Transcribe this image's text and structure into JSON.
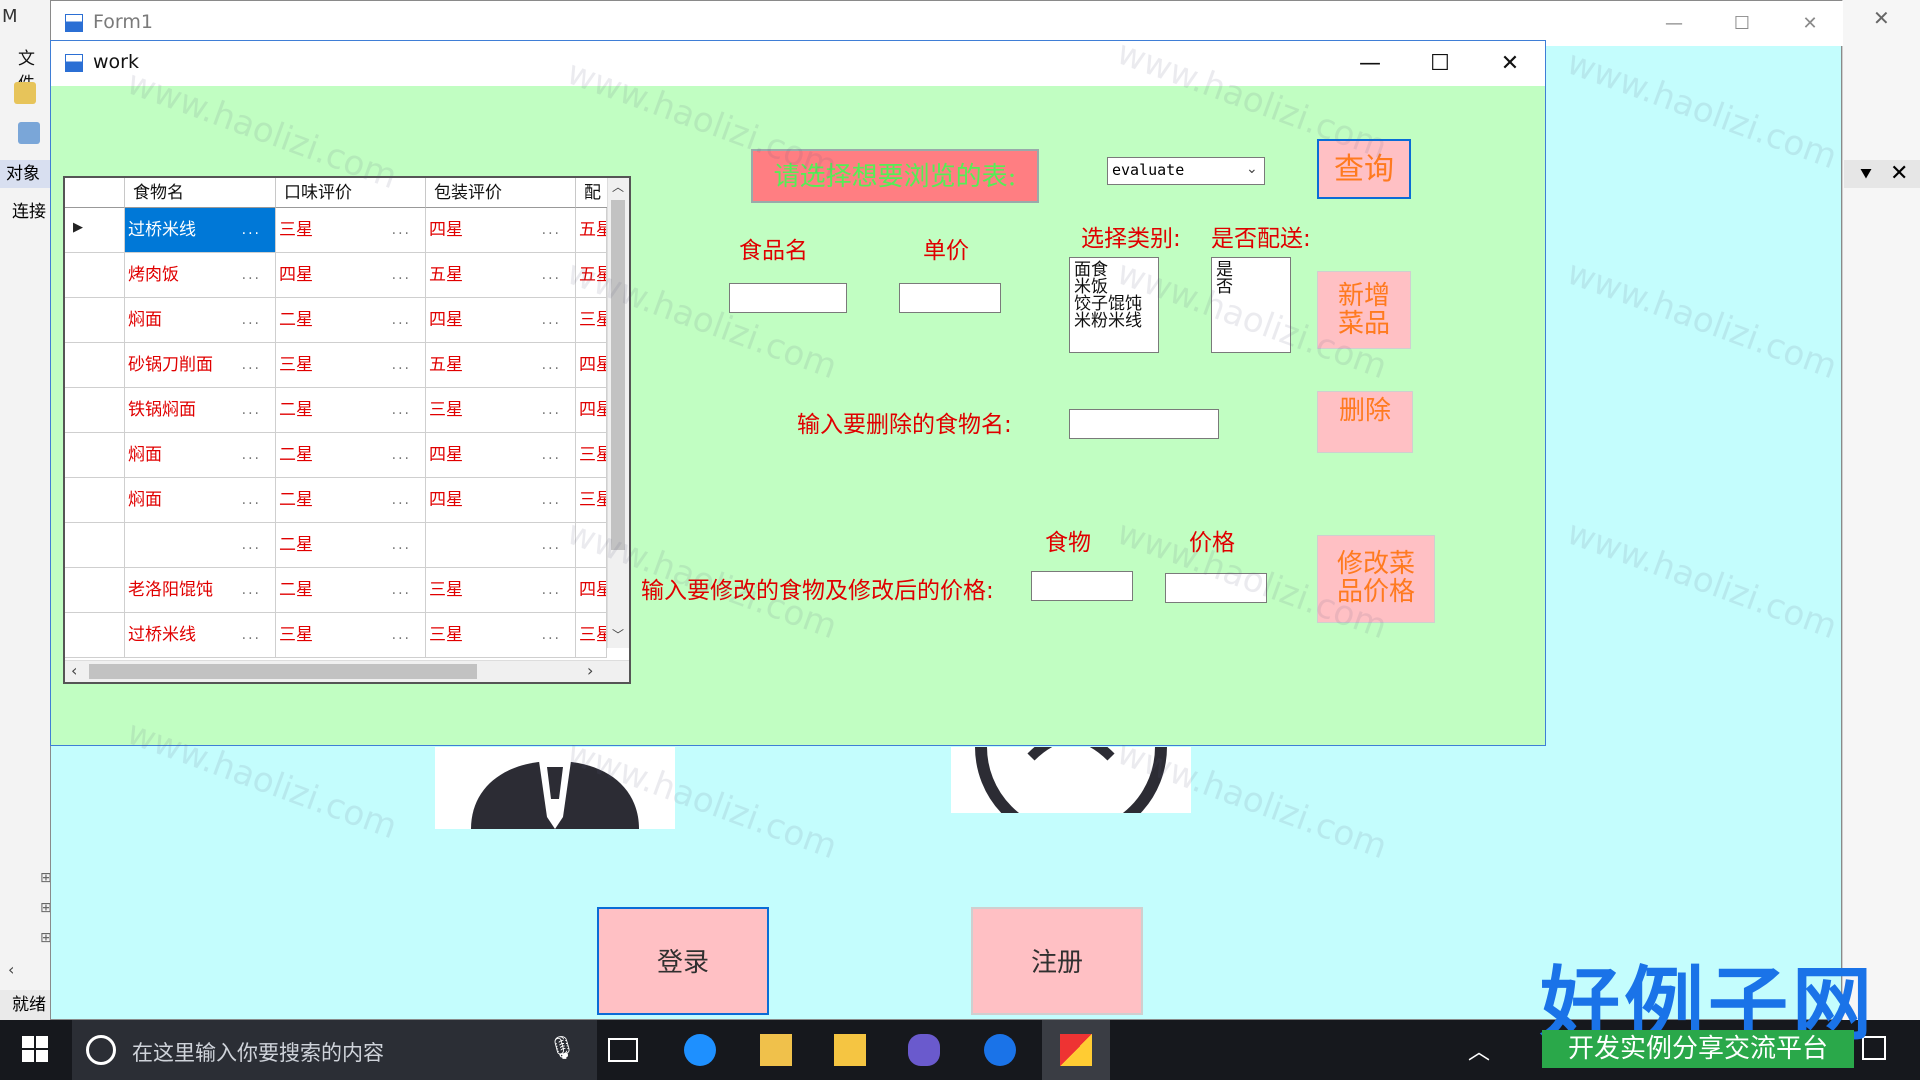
{
  "ide": {
    "title_fragment": "M",
    "menu_fragment": "文件",
    "tab_object": "对象",
    "tab_connect": "连接",
    "status": "就绪"
  },
  "form1": {
    "title": "Form1",
    "login_button": "登录",
    "register_button": "注册"
  },
  "work": {
    "title": "work",
    "browse_label": "请选择想要浏览的表:",
    "table_select_value": "evaluate",
    "query_button": "查询",
    "food_name_label": "食品名",
    "price_label": "单价",
    "category_label": "选择类别:",
    "delivery_label": "是否配送:",
    "categories": [
      "面食",
      "米饭",
      "饺子馄饨",
      "米粉米线"
    ],
    "delivery_options": [
      "是",
      "否"
    ],
    "add_button_line1": "新增",
    "add_button_line2": "菜品",
    "delete_prompt": "输入要删除的食物名:",
    "delete_button": "删除",
    "modify_food_label": "食物",
    "modify_price_label": "价格",
    "modify_prompt": "输入要修改的食物及修改后的价格:",
    "modify_button_line1": "修改菜",
    "modify_button_line2": "品价格"
  },
  "grid": {
    "columns": [
      "食物名",
      "口味评价",
      "包装评价",
      "配"
    ],
    "dots": "...",
    "current_row_marker": "▶",
    "rows": [
      [
        "过桥米线",
        "三星",
        "四星",
        "五星"
      ],
      [
        "烤肉饭",
        "四星",
        "五星",
        "五星"
      ],
      [
        "焖面",
        "二星",
        "四星",
        "三星"
      ],
      [
        "砂锅刀削面",
        "三星",
        "五星",
        "四星"
      ],
      [
        "铁锅焖面",
        "二星",
        "三星",
        "四星"
      ],
      [
        "焖面",
        "二星",
        "四星",
        "三星"
      ],
      [
        "焖面",
        "二星",
        "四星",
        "三星"
      ],
      [
        "",
        "二星",
        "",
        ""
      ],
      [
        "老洛阳馄饨",
        "二星",
        "三星",
        "四星"
      ],
      [
        "过桥米线",
        "三星",
        "三星",
        "三星"
      ]
    ]
  },
  "taskbar": {
    "search_placeholder": "在这里输入你要搜索的内容"
  },
  "watermark": {
    "text": "www.haolizi.com",
    "logo": "好例子网",
    "logo_sub": "开发实例分享交流平台"
  }
}
